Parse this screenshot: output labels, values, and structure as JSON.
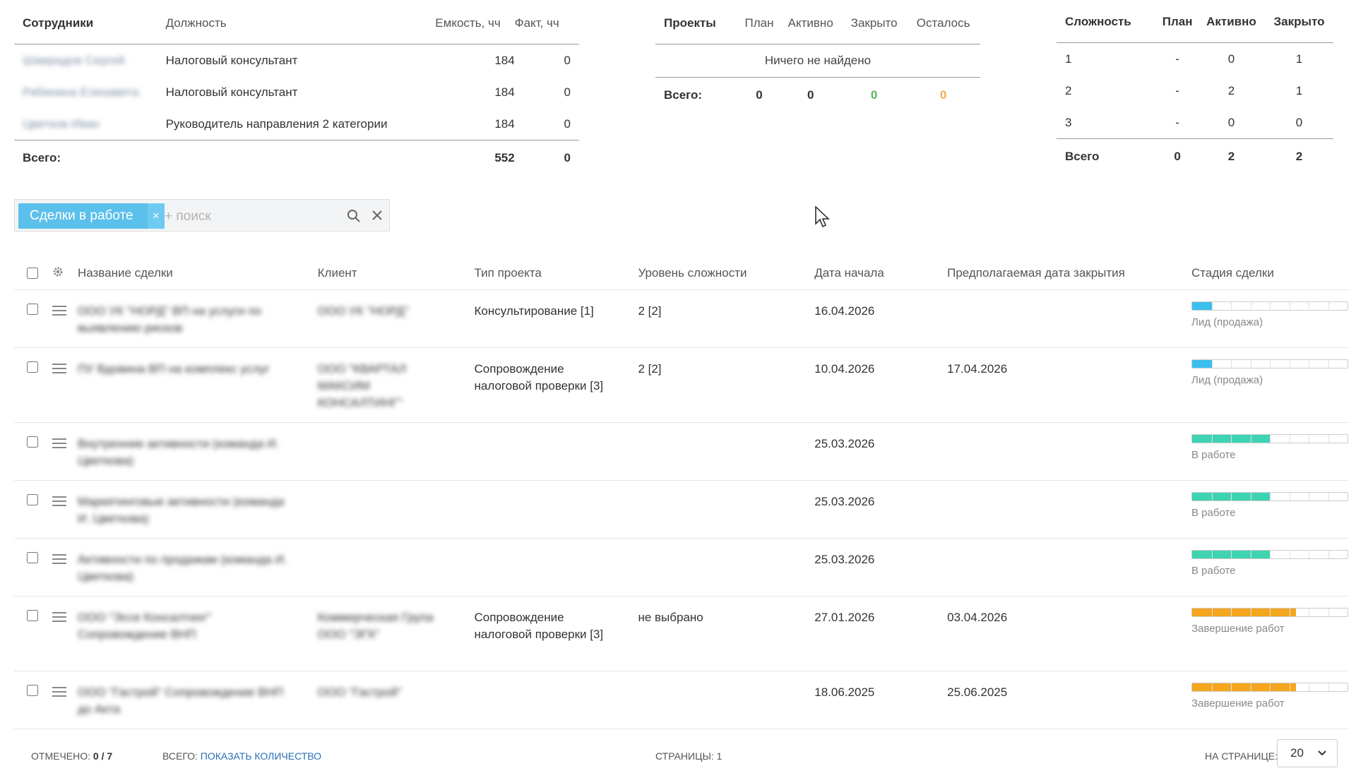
{
  "employees_table": {
    "headers": [
      "Сотрудники",
      "Должность",
      "Емкость, чч",
      "Факт, чч"
    ],
    "rows": [
      {
        "name": "Шамрадов Сергей",
        "position": "Налоговый консультант",
        "capacity": "184",
        "fact": "0"
      },
      {
        "name": "Рябинина Елизавета",
        "position": "Налоговый консультант",
        "capacity": "184",
        "fact": "0"
      },
      {
        "name": "Цветков Иван",
        "position": "Руководитель направления 2 категории",
        "capacity": "184",
        "fact": "0"
      }
    ],
    "total_label": "Всего:",
    "total_capacity": "552",
    "total_fact": "0"
  },
  "projects_table": {
    "headers": [
      "Проекты",
      "План",
      "Активно",
      "Закрыто",
      "Осталось"
    ],
    "empty_text": "Ничего не найдено",
    "total_label": "Всего:",
    "totals": [
      "0",
      "0",
      "0",
      "0"
    ]
  },
  "complexity_table": {
    "headers": [
      "Сложность",
      "План",
      "Активно",
      "Закрыто"
    ],
    "rows": [
      {
        "level": "1",
        "plan": "-",
        "active": "0",
        "closed": "1"
      },
      {
        "level": "2",
        "plan": "-",
        "active": "2",
        "closed": "1"
      },
      {
        "level": "3",
        "plan": "-",
        "active": "0",
        "closed": "0"
      }
    ],
    "total_label": "Всего",
    "totals": [
      "0",
      "2",
      "2"
    ]
  },
  "filter": {
    "tag_label": "Сделки в работе",
    "tag_remove": "×",
    "search_placeholder": "+ поиск"
  },
  "deals_table": {
    "headers": [
      "Название сделки",
      "Клиент",
      "Тип проекта",
      "Уровень сложности",
      "Дата начала",
      "Предполагаемая дата закрытия",
      "Стадия сделки"
    ],
    "rows": [
      {
        "name": "ООО УК \"НОРД\" ВП на услуги по выявлению рисков",
        "client": "ООО УК \"НОРД\"",
        "type": "Консультирование [1]",
        "complexity": "2 [2]",
        "start": "16.04.2026",
        "close": "",
        "stage": "Лид (продажа)",
        "progress": 0.125,
        "color": "#3bbfef"
      },
      {
        "name": "ПУ Вдовина ВП на комплекс услуг",
        "client": "ООО \"КВАРТАЛ МАКСИМ КОНСАЛТИНГ\"",
        "type": "Сопровождение налоговой проверки [3]",
        "complexity": "2 [2]",
        "start": "10.04.2026",
        "close": "17.04.2026",
        "stage": "Лид (продажа)",
        "progress": 0.125,
        "color": "#3bbfef"
      },
      {
        "name": "Внутренние активности (команда И. Цветкова)",
        "client": "",
        "type": "",
        "complexity": "",
        "start": "25.03.2026",
        "close": "",
        "stage": "В работе",
        "progress": 0.5,
        "color": "#3ed3b1"
      },
      {
        "name": "Маркетинговые активности (команда И. Цветкова)",
        "client": "",
        "type": "",
        "complexity": "",
        "start": "25.03.2026",
        "close": "",
        "stage": "В работе",
        "progress": 0.5,
        "color": "#3ed3b1"
      },
      {
        "name": "Активности по продажам (команда И. Цветкова)",
        "client": "",
        "type": "",
        "complexity": "",
        "start": "25.03.2026",
        "close": "",
        "stage": "В работе",
        "progress": 0.5,
        "color": "#3ed3b1"
      },
      {
        "name": "ООО \"Эссе Консалтинг\" Сопровождение ВНП",
        "client": "Коммерческая Група ООО \"ЭГК\"",
        "type": "Сопровождение налоговой проверки [3]",
        "complexity": "не выбрано",
        "start": "27.01.2026",
        "close": "03.04.2026",
        "stage": "Завершение работ",
        "progress": 0.667,
        "color": "#f5a61d"
      },
      {
        "name": "ООО \"Гастрой\" Сопровождение ВНП до Акта",
        "client": "ООО \"Гастрой\"",
        "type": "",
        "complexity": "",
        "start": "18.06.2025",
        "close": "25.06.2025",
        "stage": "Завершение работ",
        "progress": 0.667,
        "color": "#f5a61d"
      }
    ]
  },
  "footer": {
    "selected_label": "Отмечено:",
    "selected_value": "0 / 7",
    "total_label": "Всего:",
    "show_count": "показать количество",
    "pages_label": "Страницы: 1",
    "per_page_label": "На странице:",
    "per_page_value": "20"
  }
}
